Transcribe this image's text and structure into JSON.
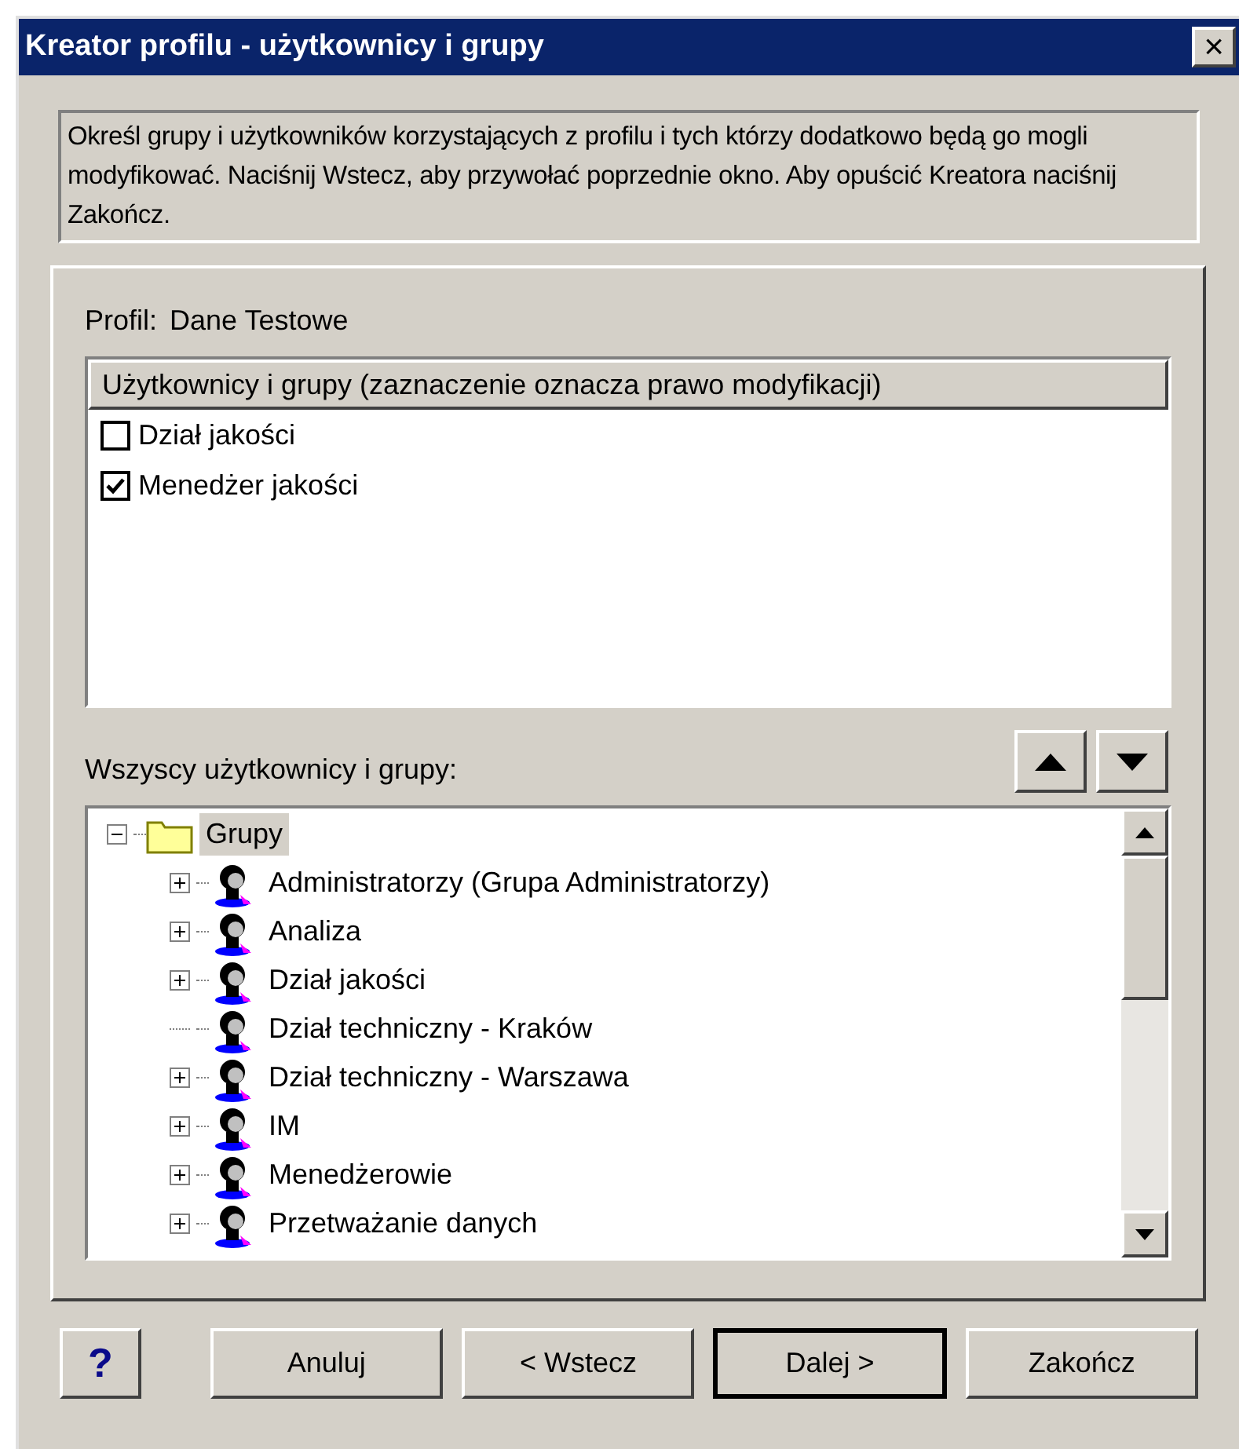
{
  "window": {
    "title": "Kreator profilu - użytkownicy i grupy",
    "close": "×"
  },
  "description": "Określ grupy i użytkowników korzystających z profilu i tych którzy dodatkowo będą go mogli modyfikować. Naciśnij Wstecz, aby przywołać poprzednie okno. Aby opuścić Kreatora naciśnij Zakończ.",
  "profile": {
    "label": "Profil:",
    "value": "Dane Testowe"
  },
  "assigned": {
    "header": "Użytkownicy i grupy (zaznaczenie oznacza prawo modyfikacji)",
    "items": [
      {
        "label": "Dział jakości",
        "checked": false
      },
      {
        "label": "Menedżer jakości",
        "checked": true
      }
    ]
  },
  "all_label": "Wszyscy użytkownicy i grupy:",
  "tree": [
    {
      "label": "Grupy",
      "kind": "folder",
      "expanded": true,
      "selected": true,
      "children": [
        {
          "label": "Administratorzy (Grupa Administratorzy)",
          "kind": "group",
          "expanded": false,
          "selected": false
        },
        {
          "label": "Analiza",
          "kind": "group",
          "expanded": false,
          "selected": false
        },
        {
          "label": "Dział jakości",
          "kind": "group",
          "expanded": false,
          "selected": false
        },
        {
          "label": "Dział techniczny - Kraków",
          "kind": "group",
          "selected": false
        },
        {
          "label": "Dział techniczny - Warszawa",
          "kind": "group",
          "expanded": false,
          "selected": false
        },
        {
          "label": "IM",
          "kind": "group",
          "expanded": false,
          "selected": false
        },
        {
          "label": "Menedżerowie",
          "kind": "group",
          "expanded": false,
          "selected": false
        },
        {
          "label": "Przetważanie danych",
          "kind": "group",
          "expanded": false,
          "selected": false
        }
      ]
    }
  ],
  "buttons": [
    {
      "label": "?",
      "kind": "help"
    },
    {
      "label": "Anuluj",
      "kind": "text",
      "default": false
    },
    {
      "label": "< Wstecz",
      "kind": "text",
      "default": false
    },
    {
      "label": "Dalej >",
      "kind": "text",
      "default": true
    },
    {
      "label": "Zakończ",
      "kind": "text",
      "default": false
    }
  ]
}
